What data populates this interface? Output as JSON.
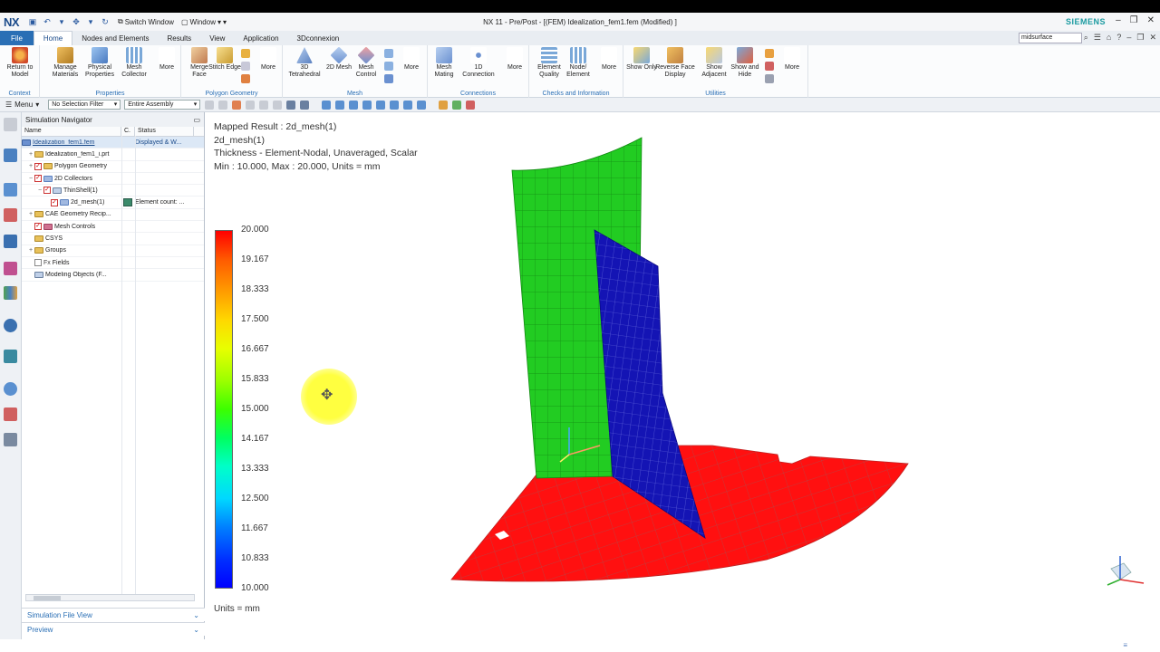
{
  "app": {
    "logo": "NX",
    "title": "NX 11 - Pre/Post - [(FEM) Idealization_fem1.fem (Modified) ]",
    "brand": "SIEMENS",
    "switch_window": "Switch Window",
    "window_menu": "Window"
  },
  "tabs": [
    "File",
    "Home",
    "Nodes and Elements",
    "Results",
    "View",
    "Application",
    "3Dconnexion"
  ],
  "search": {
    "value": "midsurface"
  },
  "ribbon": {
    "groups": [
      {
        "label": "Context",
        "buttons": [
          "Return to Model"
        ]
      },
      {
        "label": "Properties",
        "buttons": [
          "Manage Materials",
          "Physical Properties",
          "Mesh Collector",
          "More"
        ]
      },
      {
        "label": "Polygon Geometry",
        "buttons": [
          "Merge Face",
          "Stitch Edge",
          "More"
        ]
      },
      {
        "label": "Mesh",
        "buttons": [
          "3D Tetrahedral",
          "2D Mesh",
          "Mesh Control",
          "More"
        ]
      },
      {
        "label": "Connections",
        "buttons": [
          "Mesh Mating",
          "1D Connection",
          "More"
        ]
      },
      {
        "label": "Checks and Information",
        "buttons": [
          "Element Quality",
          "Node/ Element",
          "More"
        ]
      },
      {
        "label": "Utilities",
        "buttons": [
          "Show Only",
          "Reverse Face Display",
          "Show Adjacent",
          "Show and Hide",
          "More"
        ]
      }
    ]
  },
  "toolbar": {
    "menu": "Menu",
    "selection_filter": "No Selection Filter",
    "assembly": "Entire Assembly"
  },
  "navigator": {
    "title": "Simulation Navigator",
    "columns": [
      "Name",
      "C.",
      "Status"
    ],
    "rows": [
      {
        "name": "Idealization_fem1.fem",
        "status": "Displayed & W..."
      },
      {
        "name": "Idealization_fem1_i.prt",
        "status": ""
      },
      {
        "name": "Polygon Geometry",
        "status": ""
      },
      {
        "name": "2D Collectors",
        "status": ""
      },
      {
        "name": "ThinShell(1)",
        "status": ""
      },
      {
        "name": "2d_mesh(1)",
        "status": "Element count: ..."
      },
      {
        "name": "CAE Geometry Recip...",
        "status": ""
      },
      {
        "name": "Mesh Controls",
        "status": ""
      },
      {
        "name": "CSYS",
        "status": ""
      },
      {
        "name": "Groups",
        "status": ""
      },
      {
        "name": "Fields",
        "status": ""
      },
      {
        "name": "Modeling Objects (F...",
        "status": ""
      }
    ],
    "footer": [
      "Simulation File View",
      "Preview"
    ]
  },
  "viewport": {
    "result_lines": [
      "Mapped Result : 2d_mesh(1)",
      "2d_mesh(1)",
      "Thickness - Element-Nodal, Unaveraged, Scalar",
      "Min : 10.000, Max : 20.000, Units = mm"
    ],
    "legend_values": [
      "20.000",
      "19.167",
      "18.333",
      "17.500",
      "16.667",
      "15.833",
      "15.000",
      "14.167",
      "13.333",
      "12.500",
      "11.667",
      "10.833",
      "10.000"
    ],
    "units_label": "Units = mm",
    "colors": {
      "max": "#ff0000",
      "mid": "#3cff00",
      "min": "#0000ff",
      "mesh_green": "#22cc22",
      "mesh_blue": "#1414b4",
      "mesh_red": "#ff1010"
    }
  }
}
